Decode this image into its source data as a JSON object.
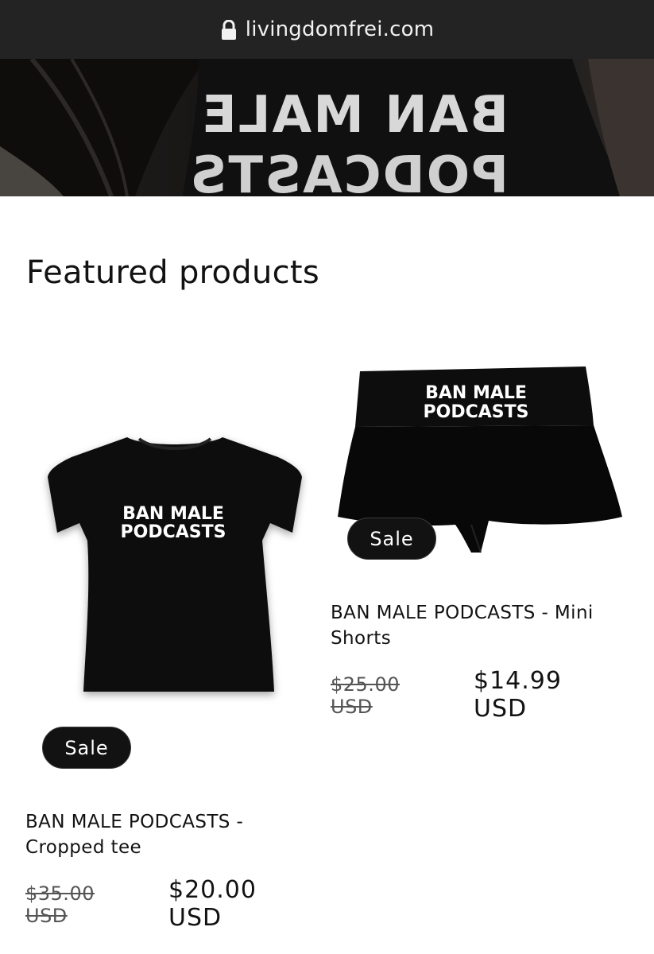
{
  "browser": {
    "url": "livingdomfrei.com",
    "lock_icon": "lock-icon"
  },
  "hero": {
    "shirt_text": [
      "BAN MALE",
      "PODCASTS"
    ]
  },
  "section": {
    "heading": "Featured products"
  },
  "products": [
    {
      "name": "BAN MALE PODCASTS - Cropped tee",
      "print_text": [
        "BAN MALE",
        "PODCASTS"
      ],
      "badge": "Sale",
      "compare_price": "$35.00 USD",
      "sale_price": "$20.00 USD"
    },
    {
      "name": "BAN MALE PODCASTS - Mini Shorts",
      "print_text": [
        "BAN MALE",
        "PODCASTS"
      ],
      "badge": "Sale",
      "compare_price": "$25.00 USD",
      "sale_price": "$14.99 USD"
    }
  ],
  "colors": {
    "topbar": "#232323",
    "badge": "#121212",
    "text": "#121212",
    "garment": "#0b0b0b"
  }
}
